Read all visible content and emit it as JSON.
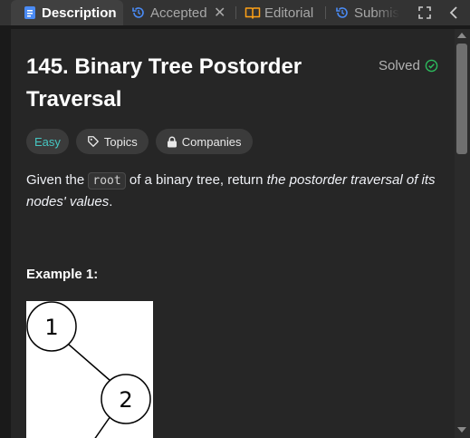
{
  "tabs": {
    "description": "Description",
    "accepted": "Accepted",
    "editorial": "Editorial",
    "submissions": "Submis"
  },
  "problem": {
    "title": "145. Binary Tree Postorder Traversal",
    "status": "Solved",
    "status_color": "#2cbb5d",
    "difficulty": "Easy",
    "difficulty_color": "#46c6c2",
    "topics_label": "Topics",
    "companies_label": "Companies",
    "description": {
      "prefix": "Given the",
      "code": "root",
      "middle": "of a binary tree, return",
      "emphasis": "the postorder traversal of its nodes' values",
      "suffix": "."
    },
    "example1_title": "Example 1:",
    "tree_nodes": [
      "1",
      "2"
    ]
  }
}
